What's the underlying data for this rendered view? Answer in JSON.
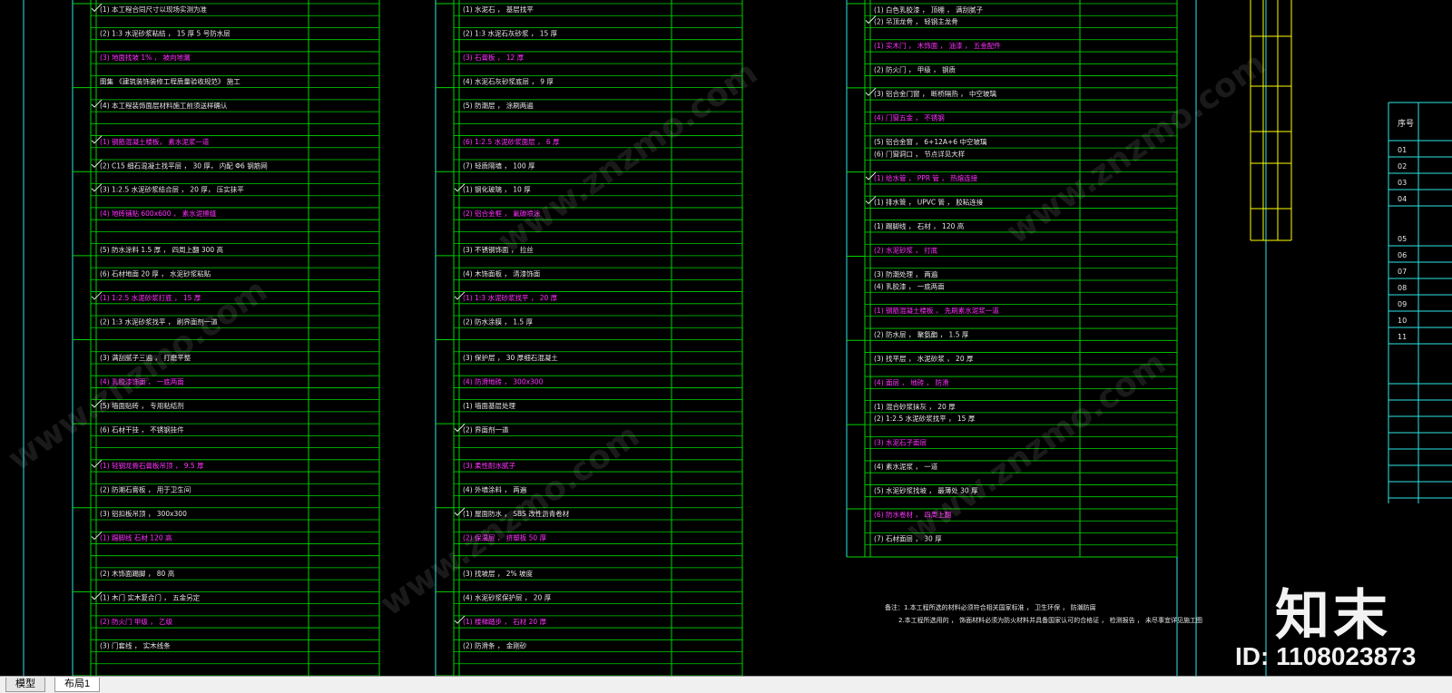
{
  "tabs": [
    {
      "label": "模型"
    },
    {
      "label": "布局1"
    }
  ],
  "watermark": {
    "brand": "知末",
    "id": "ID: 1108023873",
    "site": "www.znzmo.com"
  },
  "colors": {
    "grid": "#00d400",
    "text": "#e8e8e8",
    "magenta": "#ff33ff",
    "cyan": "#2ee6e6",
    "yellow": "#ffff00"
  },
  "notes": {
    "line1": "备注：1.本工程所选的材料必须符合相关国家标准 ，  卫生环保 ，  防潮防腐",
    "line2": "2.本工程所选用的 ，  饰面材料必须为防火材料并具备国家认可的合格证 ，  检测报告 ，  未尽事宜详见施工图"
  },
  "columns": [
    {
      "rows": [
        {
          "text": "(1) 本工程合同尺寸以现场实测为准",
          "tick": true
        },
        {
          "text": "(2) 1:3 水泥砂浆粘结 ，  15 厚 5 号防水层",
          "tick": false
        },
        {
          "text": "(3) 地面找坡 1% ，  坡向地漏",
          "tick": false
        },
        {
          "text": "图集 《建筑装饰装修工程质量验收规范》  施工",
          "tick": false
        },
        {
          "text": "(4) 本工程装饰面层材料施工前须送样确认",
          "tick": true
        },
        {
          "text": "(1) 钢筋混凝土楼板，  素水泥浆一道",
          "tick": true
        },
        {
          "text": "(2) C15 细石混凝土找平层 ，  30 厚，  内配 Φ6 钢筋网",
          "tick": true
        },
        {
          "text": "(3) 1:2.5 水泥砂浆结合层 ，  20 厚，  压实抹平",
          "tick": true
        },
        {
          "text": "(4) 地砖铺贴 600x600 ，  素水泥擦缝",
          "tick": false
        },
        {
          "text": "(5) 防水涂料 1.5 厚 ，  四周上翻 300 高",
          "tick": false
        },
        {
          "text": "(6) 石材地面  20 厚 ，  水泥砂浆粘贴",
          "tick": false
        },
        {
          "text": "(1) 1:2.5 水泥砂浆打底 ，  15 厚",
          "tick": true
        },
        {
          "text": "(2) 1:3 水泥砂浆找平 ，  刷界面剂一道",
          "tick": false
        },
        {
          "text": "(3) 满刮腻子三遍 ，  打磨平整",
          "tick": false
        },
        {
          "text": "(4) 乳胶漆饰面 ，  一底两面",
          "tick": false
        },
        {
          "text": "(5) 墙面贴砖 ，  专用粘结剂",
          "tick": true
        },
        {
          "text": "(6) 石材干挂 ，  不锈钢挂件",
          "tick": false
        },
        {
          "text": "(1) 轻钢龙骨石膏板吊顶 ，  9.5 厚",
          "tick": true
        },
        {
          "text": "(2) 防潮石膏板 ，  用于卫生间",
          "tick": false
        },
        {
          "text": "(3) 铝扣板吊顶 ，  300x300",
          "tick": false
        },
        {
          "text": "(1) 踢脚线  石材 120 高",
          "tick": true
        },
        {
          "text": "(2) 木饰面踢脚 ，  80 高",
          "tick": false
        },
        {
          "text": "(1) 木门  实木复合门 ，  五金另定",
          "tick": true
        },
        {
          "text": "(2) 防火门 甲级 ，  乙级",
          "tick": false
        },
        {
          "text": "(3) 门套线 ，  实木线条",
          "tick": false
        }
      ]
    },
    {
      "rows": [
        {
          "text": "(1) 水泥石 ，  基层找平",
          "tick": false
        },
        {
          "text": "(2) 1:3 水泥石灰砂浆 ，  15 厚",
          "tick": false
        },
        {
          "text": "(3) 石膏板 ，  12 厚",
          "tick": false
        },
        {
          "text": "(4) 水泥石灰砂浆底层 ，  9 厚",
          "tick": false
        },
        {
          "text": "(5) 防潮层 ，  涂刷两遍",
          "tick": false
        },
        {
          "text": "(6) 1:2.5 水泥砂浆面层 ，  6 厚",
          "tick": false
        },
        {
          "text": "(7) 轻质隔墙 ，  100 厚",
          "tick": false
        },
        {
          "text": "(1) 钢化玻璃 ，  10 厚",
          "tick": true
        },
        {
          "text": "(2) 铝合金框 ，  氟碳喷涂",
          "tick": false
        },
        {
          "text": "(3) 不锈钢饰面 ，  拉丝",
          "tick": false
        },
        {
          "text": "(4) 木饰面板 ，  清漆饰面",
          "tick": false
        },
        {
          "text": "(1) 1:3 水泥砂浆找平 ，  20 厚",
          "tick": true
        },
        {
          "text": "(2) 防水涂膜 ，  1.5 厚",
          "tick": false
        },
        {
          "text": "(3) 保护层 ，  30 厚细石混凝土",
          "tick": false
        },
        {
          "text": "(4) 防滑地砖 ，  300x300",
          "tick": false
        },
        {
          "text": "(1) 墙面基层处理",
          "tick": false
        },
        {
          "text": "(2) 界面剂一道",
          "tick": true
        },
        {
          "text": "(3) 柔性耐水腻子",
          "tick": false
        },
        {
          "text": "(4) 外墙涂料 ，  两遍",
          "tick": false
        },
        {
          "text": "(1) 屋面防水 ，  SBS 改性沥青卷材",
          "tick": true
        },
        {
          "text": "(2) 保温层 ，  挤塑板 50 厚",
          "tick": false
        },
        {
          "text": "(3) 找坡层 ，  2% 坡度",
          "tick": false
        },
        {
          "text": "(4) 水泥砂浆保护层 ，  20 厚",
          "tick": false
        },
        {
          "text": "(1) 楼梯踏步 ，  石材 20 厚",
          "tick": true
        },
        {
          "text": "(2) 防滑条 ，  金刚砂",
          "tick": false
        }
      ]
    },
    {
      "rows": [
        {
          "text": "(1) 白色乳胶漆 ，  顶棚 ，  满刮腻子",
          "tick": false
        },
        {
          "text": "(2) 吊顶龙骨 ，  轻钢主龙骨",
          "tick": true
        },
        {
          "text": "(1) 实木门 ，  木饰面 ，  油漆 ，  五金配件",
          "tick": false
        },
        {
          "text": "(2) 防火门 ，  甲级 ，  钢质",
          "tick": false
        },
        {
          "text": "(3) 铝合金门窗 ，  断桥隔热 ，  中空玻璃",
          "tick": true
        },
        {
          "text": "(4) 门窗五金 ，  不锈钢",
          "tick": false
        },
        {
          "text": "(5) 铝合金窗 ，  6+12A+6 中空玻璃",
          "tick": false
        },
        {
          "text": "(6) 门窗洞口 ，  节点详见大样",
          "tick": false
        },
        {
          "text": "(1) 给水管 ，  PPR 管 ，  热熔连接",
          "tick": true
        },
        {
          "text": "(1) 排水管 ，  UPVC 管 ，  胶粘连接",
          "tick": true
        },
        {
          "text": "(1) 踢脚线 ，  石材 ，  120 高",
          "tick": false
        },
        {
          "text": "(2) 水泥砂浆 ，  打底",
          "tick": false
        },
        {
          "text": "(3) 防潮处理 ，  两遍",
          "tick": false
        },
        {
          "text": "(4) 乳胶漆 ，  一底两面",
          "tick": false
        },
        {
          "text": "(1) 钢筋混凝土楼板 ，  先刷素水泥浆一道",
          "tick": false
        },
        {
          "text": "(2) 防水层 ，  聚氨酯 ，  1.5 厚",
          "tick": false
        },
        {
          "text": "(3) 找平层 ，  水泥砂浆 ，  20 厚",
          "tick": false
        },
        {
          "text": "(4) 面层 ，  地砖 ，  防滑",
          "tick": false
        },
        {
          "text": "(1) 混合砂浆抹灰 ，  20 厚",
          "tick": false
        },
        {
          "text": "(2) 1:2.5 水泥砂浆找平 ，  15 厚",
          "tick": false
        },
        {
          "text": "(3) 水泥石子面层",
          "tick": false
        },
        {
          "text": "(4) 素水泥浆 ，  一道",
          "tick": false
        },
        {
          "text": "(5) 水泥砂浆找坡 ，  最薄处 30 厚",
          "tick": false
        },
        {
          "text": "(6) 防水卷材 ，  四周上翻",
          "tick": false
        },
        {
          "text": "(7) 石材面层 ，  30 厚",
          "tick": false
        }
      ]
    }
  ],
  "index_table": {
    "header": "序号",
    "rows": [
      "01",
      "02",
      "03",
      "04",
      "05",
      "06",
      "07",
      "08",
      "09",
      "10",
      "11"
    ]
  }
}
